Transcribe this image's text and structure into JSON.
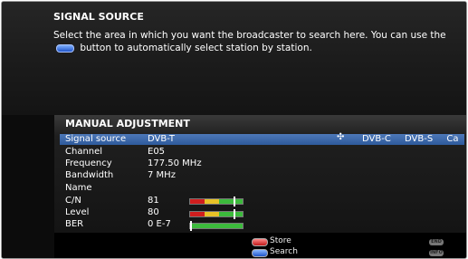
{
  "header": {
    "title": "SIGNAL SOURCE",
    "help_prefix": "Select the area in which you want the broadcaster to search here. You can use the",
    "help_suffix": "button to automatically select station by station.",
    "inline_button_icon": "blue-button-icon"
  },
  "menu": {
    "title": "MANUAL ADJUSTMENT",
    "rows": [
      {
        "label": "Signal source",
        "value": "DVB-T"
      },
      {
        "label": "Channel",
        "value": "E05"
      },
      {
        "label": "Frequency",
        "value": "177.50 MHz"
      },
      {
        "label": "Bandwidth",
        "value": "7 MHz"
      },
      {
        "label": "Name",
        "value": ""
      },
      {
        "label": "C/N",
        "value": "81"
      },
      {
        "label": "Level",
        "value": "80"
      },
      {
        "label": "BER",
        "value": "0 E-7"
      }
    ],
    "options_arrow_icon": "left-right-arrows-icon",
    "other_options": [
      "DVB-C",
      "DVB-S",
      "Ca"
    ]
  },
  "footer": {
    "store_label": "Store",
    "search_label": "Search",
    "end_key": "END",
    "info_key": "INFO"
  },
  "colors": {
    "selection": "#3c67a8",
    "red_key": "#d01e1e",
    "blue_key": "#1f55c8"
  }
}
